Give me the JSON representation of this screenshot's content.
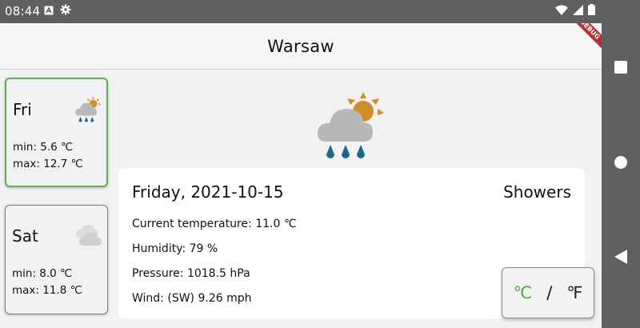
{
  "status_bar": {
    "time": "08:44"
  },
  "app_bar": {
    "title": "Warsaw",
    "debug_label": "DEBUG"
  },
  "days": [
    {
      "name": "Fri",
      "min": "min: 5.6 ℃",
      "max": "max: 12.7 ℃",
      "icon": "showers-icon",
      "selected": true
    },
    {
      "name": "Sat",
      "min": "min: 8.0 ℃",
      "max": "max: 11.8 ℃",
      "icon": "cloudy-icon",
      "selected": false
    }
  ],
  "detail": {
    "icon": "showers-icon",
    "date": "Friday, 2021-10-15",
    "summary": "Showers",
    "current_temp": "Current temperature: 11.0 ℃",
    "humidity": "Humidity: 79 %",
    "pressure": "Pressure: 1018.5 hPa",
    "wind": "Wind: (SW) 9.26 mph"
  },
  "unit_toggle": {
    "celsius": "℃",
    "separator": "/",
    "fahrenheit": "℉"
  },
  "colors": {
    "accent": "#5fb34e",
    "rain": "#1a6a86",
    "sun": "#d08f2e",
    "cloud": "#b8b8ba"
  }
}
